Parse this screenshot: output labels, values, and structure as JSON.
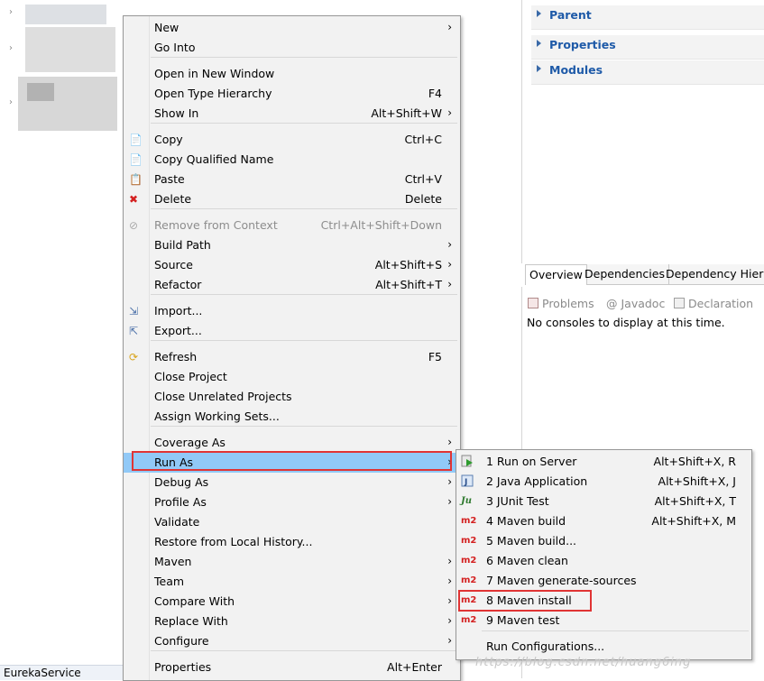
{
  "explorer": {
    "project_label": "EurekaService"
  },
  "pom_sections": [
    "Parent",
    "Properties",
    "Modules"
  ],
  "editor_tabs": [
    "Overview",
    "Dependencies",
    "Dependency Hierar"
  ],
  "console": {
    "tabs": [
      "Problems",
      "@ Javadoc",
      "Declaration"
    ],
    "message": "No consoles to display at this time."
  },
  "menu": {
    "items": [
      {
        "label": "New",
        "shortcut": "",
        "submenu": true
      },
      {
        "label": "Go Into",
        "shortcut": ""
      },
      {
        "label": "Open in New Window",
        "shortcut": ""
      },
      {
        "label": "Open Type Hierarchy",
        "shortcut": "F4"
      },
      {
        "label": "Show In",
        "shortcut": "Alt+Shift+W",
        "submenu": true
      },
      {
        "label": "Copy",
        "shortcut": "Ctrl+C",
        "icon": "copy-icon"
      },
      {
        "label": "Copy Qualified Name",
        "shortcut": "",
        "icon": "copy-qualified-icon"
      },
      {
        "label": "Paste",
        "shortcut": "Ctrl+V",
        "icon": "paste-icon"
      },
      {
        "label": "Delete",
        "shortcut": "Delete",
        "icon": "delete-icon"
      },
      {
        "label": "Remove from Context",
        "shortcut": "Ctrl+Alt+Shift+Down",
        "disabled": true,
        "icon": "remove-context-icon"
      },
      {
        "label": "Build Path",
        "shortcut": "",
        "submenu": true
      },
      {
        "label": "Source",
        "shortcut": "Alt+Shift+S",
        "submenu": true
      },
      {
        "label": "Refactor",
        "shortcut": "Alt+Shift+T",
        "submenu": true
      },
      {
        "label": "Import...",
        "shortcut": "",
        "icon": "import-icon"
      },
      {
        "label": "Export...",
        "shortcut": "",
        "icon": "export-icon"
      },
      {
        "label": "Refresh",
        "shortcut": "F5",
        "icon": "refresh-icon"
      },
      {
        "label": "Close Project",
        "shortcut": ""
      },
      {
        "label": "Close Unrelated Projects",
        "shortcut": ""
      },
      {
        "label": "Assign Working Sets...",
        "shortcut": ""
      },
      {
        "label": "Coverage As",
        "shortcut": "",
        "submenu": true
      },
      {
        "label": "Run As",
        "shortcut": "",
        "submenu": true,
        "selected": true
      },
      {
        "label": "Debug As",
        "shortcut": "",
        "submenu": true
      },
      {
        "label": "Profile As",
        "shortcut": "",
        "submenu": true
      },
      {
        "label": "Validate",
        "shortcut": ""
      },
      {
        "label": "Restore from Local History...",
        "shortcut": ""
      },
      {
        "label": "Maven",
        "shortcut": "",
        "submenu": true
      },
      {
        "label": "Team",
        "shortcut": "",
        "submenu": true
      },
      {
        "label": "Compare With",
        "shortcut": "",
        "submenu": true
      },
      {
        "label": "Replace With",
        "shortcut": "",
        "submenu": true
      },
      {
        "label": "Configure",
        "shortcut": "",
        "submenu": true
      },
      {
        "label": "Properties",
        "shortcut": "Alt+Enter"
      }
    ]
  },
  "run_as_submenu": {
    "items": [
      {
        "label": "1 Run on Server",
        "shortcut": "Alt+Shift+X, R",
        "icon": "run-server-icon"
      },
      {
        "label": "2 Java Application",
        "shortcut": "Alt+Shift+X, J",
        "icon": "java-app-icon"
      },
      {
        "label": "3 JUnit Test",
        "shortcut": "Alt+Shift+X, T",
        "icon": "junit-icon",
        "icon_text": "Ju"
      },
      {
        "label": "4 Maven build",
        "shortcut": "Alt+Shift+X, M",
        "icon": "maven-icon",
        "icon_text": "m2"
      },
      {
        "label": "5 Maven build...",
        "shortcut": "",
        "icon": "maven-icon",
        "icon_text": "m2"
      },
      {
        "label": "6 Maven clean",
        "shortcut": "",
        "icon": "maven-icon",
        "icon_text": "m2"
      },
      {
        "label": "7 Maven generate-sources",
        "shortcut": "",
        "icon": "maven-icon",
        "icon_text": "m2"
      },
      {
        "label": "8 Maven install",
        "shortcut": "",
        "icon": "maven-icon",
        "icon_text": "m2"
      },
      {
        "label": "9 Maven test",
        "shortcut": "",
        "icon": "maven-icon",
        "icon_text": "m2"
      },
      {
        "label": "Run Configurations...",
        "shortcut": ""
      }
    ]
  },
  "watermark": "https://blog.csdn.net/huang6ing"
}
